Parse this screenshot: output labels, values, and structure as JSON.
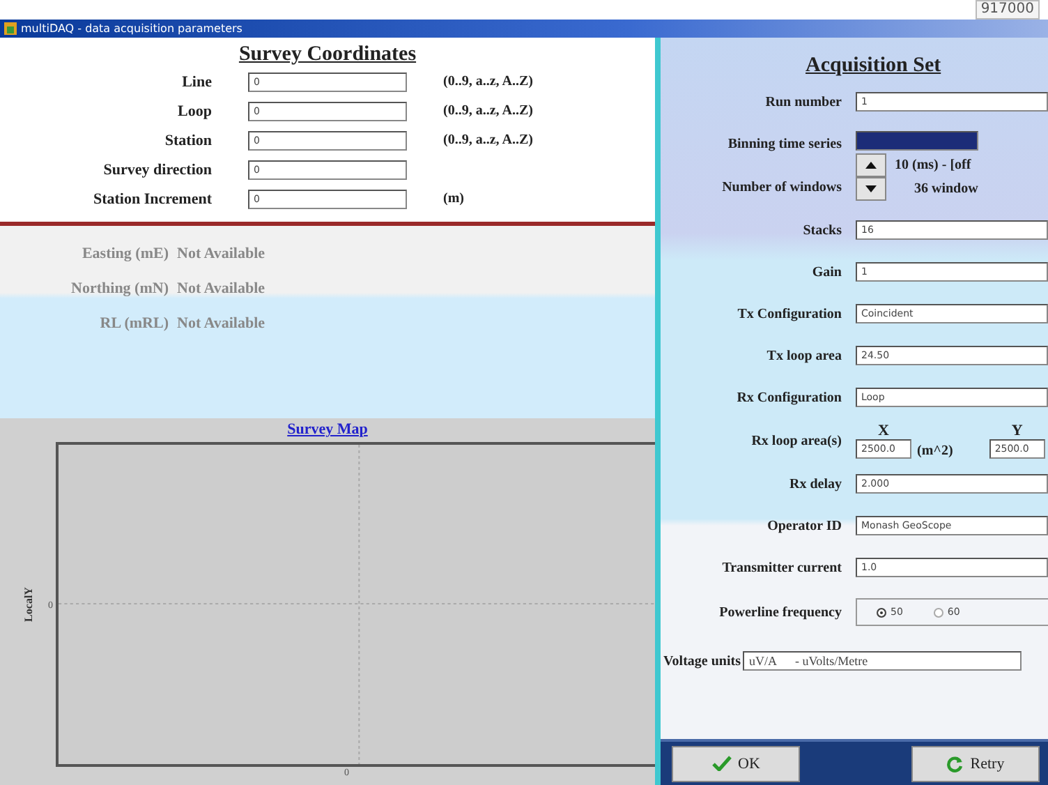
{
  "top_strip": {
    "value": "917000"
  },
  "window": {
    "title": "multiDAQ - data acquisition parameters"
  },
  "survey": {
    "title": "Survey Coordinates",
    "fields": [
      {
        "label": "Line",
        "value": "0",
        "hint": "(0..9, a..z, A..Z)"
      },
      {
        "label": "Loop",
        "value": "0",
        "hint": "(0..9, a..z, A..Z)"
      },
      {
        "label": "Station",
        "value": "0",
        "hint": "(0..9, a..z, A..Z)"
      },
      {
        "label": "Survey direction",
        "value": "0"
      },
      {
        "label": "Station Increment",
        "value": "0",
        "hint": "(m)"
      }
    ]
  },
  "position": [
    {
      "label": "Easting (mE)",
      "value": "Not Available"
    },
    {
      "label": "Northing (mN)",
      "value": "Not Available"
    },
    {
      "label": "RL (mRL)",
      "value": "Not Available"
    }
  ],
  "map": {
    "title": "Survey Map",
    "y_label": "LocalY",
    "y_tick": "0",
    "x_tick": "0"
  },
  "acquisition": {
    "title": "Acquisition Set",
    "rows": [
      {
        "kind": "text",
        "label": "Run number",
        "value": "1"
      },
      {
        "kind": "binning",
        "label": "Binning time series",
        "label2": "Number of windows",
        "info": [
          "10 (ms) - [off",
          "36 window"
        ]
      },
      {
        "kind": "text",
        "label": "Stacks",
        "value": "16"
      },
      {
        "kind": "text",
        "label": "Gain",
        "value": "1"
      },
      {
        "kind": "select",
        "label": "Tx Configuration",
        "value": "Coincident"
      },
      {
        "kind": "text",
        "label": "Tx loop area",
        "value": "24.50"
      },
      {
        "kind": "select",
        "label": "Rx Configuration",
        "value": "Loop"
      },
      {
        "kind": "pair",
        "label": "Rx loop area(s)",
        "x_label": "X",
        "x_value": "2500.0",
        "unit": "(m^2)",
        "y_label": "Y",
        "y_value": "2500.0"
      },
      {
        "kind": "text",
        "label": "Rx delay",
        "value": "2.000"
      },
      {
        "kind": "text",
        "label": "Operator ID",
        "value": "Monash GeoScope"
      },
      {
        "kind": "text",
        "label": "Transmitter current",
        "value": "1.0"
      },
      {
        "kind": "radio",
        "label": "Powerline frequency",
        "options": [
          {
            "label": "50",
            "selected": true
          },
          {
            "label": "60",
            "selected": false
          }
        ]
      },
      {
        "kind": "units",
        "label": "Voltage units",
        "value": "uV/A      - uVolts/Metre"
      }
    ]
  },
  "buttons": [
    {
      "kind": "ok",
      "label": "OK"
    },
    {
      "kind": "retry",
      "label": "Retry"
    }
  ]
}
